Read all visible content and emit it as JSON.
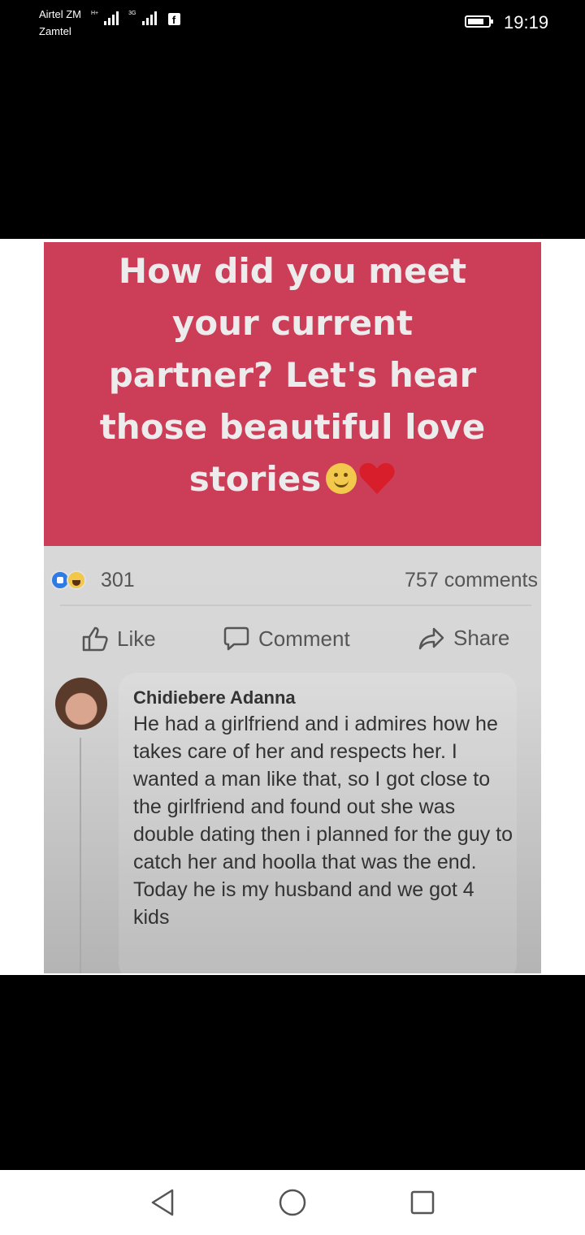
{
  "status_bar": {
    "carrier_1": "Airtel ZM",
    "carrier_2": "Zamtel",
    "network_1": "H+",
    "network_2": "3G",
    "time": "19:19",
    "app_badge_icon": "facebook-icon"
  },
  "post": {
    "banner_color": "#cc3d58",
    "question": "How did you meet your current partner? Let's hear those beautiful love stories",
    "question_lines": [
      "How did you meet",
      "your current",
      "partner? Let's hear",
      "those beautiful love",
      "stories"
    ],
    "reaction_count": "301",
    "comments_count": "757 comments",
    "actions": {
      "like_label": "Like",
      "comment_label": "Comment",
      "share_label": "Share"
    },
    "comment": {
      "author": "Chidiebere Adanna",
      "text": "He had a girlfriend and i admires how he takes care of her and respects her. I wanted a man like that, so I got close to the girlfriend and found out she was double dating then i planned for the guy to catch her and hoolla that was the end. Today he is my husband and we got 4 kids"
    }
  },
  "navigation": {
    "back_icon": "back-triangle-icon",
    "home_icon": "home-circle-icon",
    "recents_icon": "recents-square-icon"
  }
}
